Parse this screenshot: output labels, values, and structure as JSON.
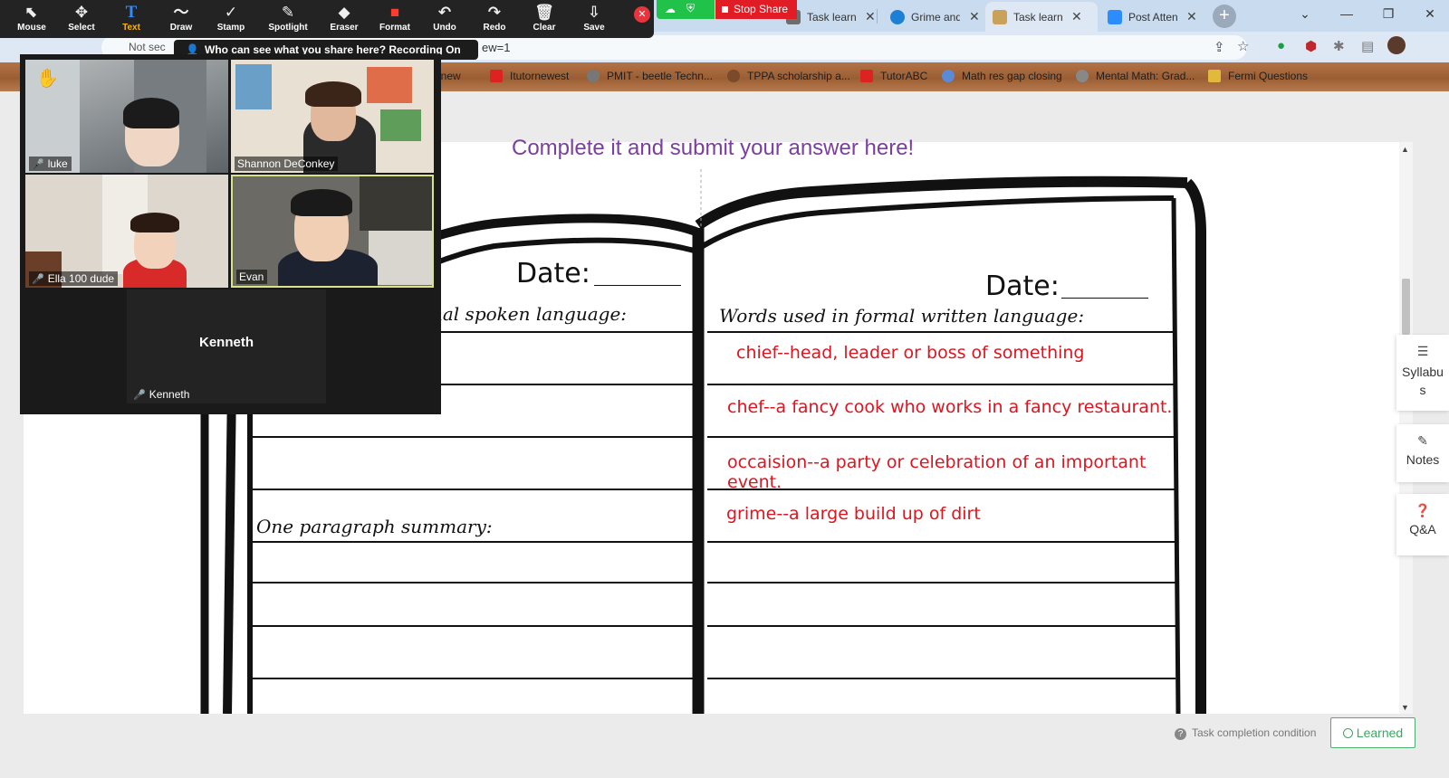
{
  "zoom_toolbar": {
    "tools": [
      {
        "label": "Mouse",
        "icon": "⬉"
      },
      {
        "label": "Select",
        "icon": "✥"
      },
      {
        "label": "Text",
        "icon": "T"
      },
      {
        "label": "Draw",
        "icon": "〜"
      },
      {
        "label": "Stamp",
        "icon": "✓"
      },
      {
        "label": "Spotlight",
        "icon": "✎"
      },
      {
        "label": "Eraser",
        "icon": "◆"
      },
      {
        "label": "Format",
        "icon": "■"
      },
      {
        "label": "Undo",
        "icon": "↶"
      },
      {
        "label": "Redo",
        "icon": "↷"
      },
      {
        "label": "Clear",
        "icon": "🗑"
      },
      {
        "label": "Save",
        "icon": "⇩"
      }
    ],
    "active_tool": "Text",
    "stop_share_label": "Stop Share",
    "share_notice": "Who can see what you share here? Recording On"
  },
  "browser": {
    "tabs": [
      {
        "label": "Task learni",
        "icon_color": "#6d6d6d"
      },
      {
        "label": "Grime and",
        "icon_color": "#1e7fd6"
      },
      {
        "label": "Task learni",
        "icon_color": "#c9a15a"
      },
      {
        "label": "Post Atten",
        "icon_color": "#2d8cff"
      }
    ],
    "url_fragment": "ew=1",
    "not_secure_label": "Not sec"
  },
  "bookmarks": [
    {
      "label": "itornew",
      "icon_color": "#d33"
    },
    {
      "label": "Itutornewest",
      "icon_color": "#d22"
    },
    {
      "label": "PMIT - beetle Techn...",
      "icon_color": "#777"
    },
    {
      "label": "TPPA scholarship a...",
      "icon_color": "#7a4a2a"
    },
    {
      "label": "TutorABC",
      "icon_color": "#d22"
    },
    {
      "label": "Math res gap closing",
      "icon_color": "#5b8bd8"
    },
    {
      "label": "Mental Math: Grad...",
      "icon_color": "#888"
    },
    {
      "label": "Fermi Questions",
      "icon_color": "#e2b93b"
    }
  ],
  "gallery": {
    "participants": [
      "luke",
      "Shannon DeConkey",
      "Ella 100 dude",
      "Evan"
    ],
    "no_video_name": "Kenneth",
    "no_video_label": "Kenneth"
  },
  "page": {
    "prompt": "Complete it and submit your answer here!",
    "date_label_left": "Date:",
    "date_label_right": "Date:",
    "left_heading": "nal spoken language:",
    "right_heading": "Words used in formal written language:",
    "summary_heading": "One paragraph summary:",
    "answers": [
      "chief--head, leader or boss of something",
      "chef--a fancy cook who works in a fancy restaurant.",
      "occaision--a party or celebration of an important",
      "event.",
      "grime--a large build up of dirt"
    ]
  },
  "side_panels": {
    "syllabus_label": "Syllabu s",
    "notes_label": "Notes",
    "qa_label": "Q&A"
  },
  "footer": {
    "task_condition": "Task completion condition",
    "learned_label": "Learned"
  },
  "colors": {
    "prompt": "#7b3ea1",
    "answer_red": "#e0141e",
    "stop_share": "#e11c24",
    "learned_green": "#3ba85f"
  }
}
